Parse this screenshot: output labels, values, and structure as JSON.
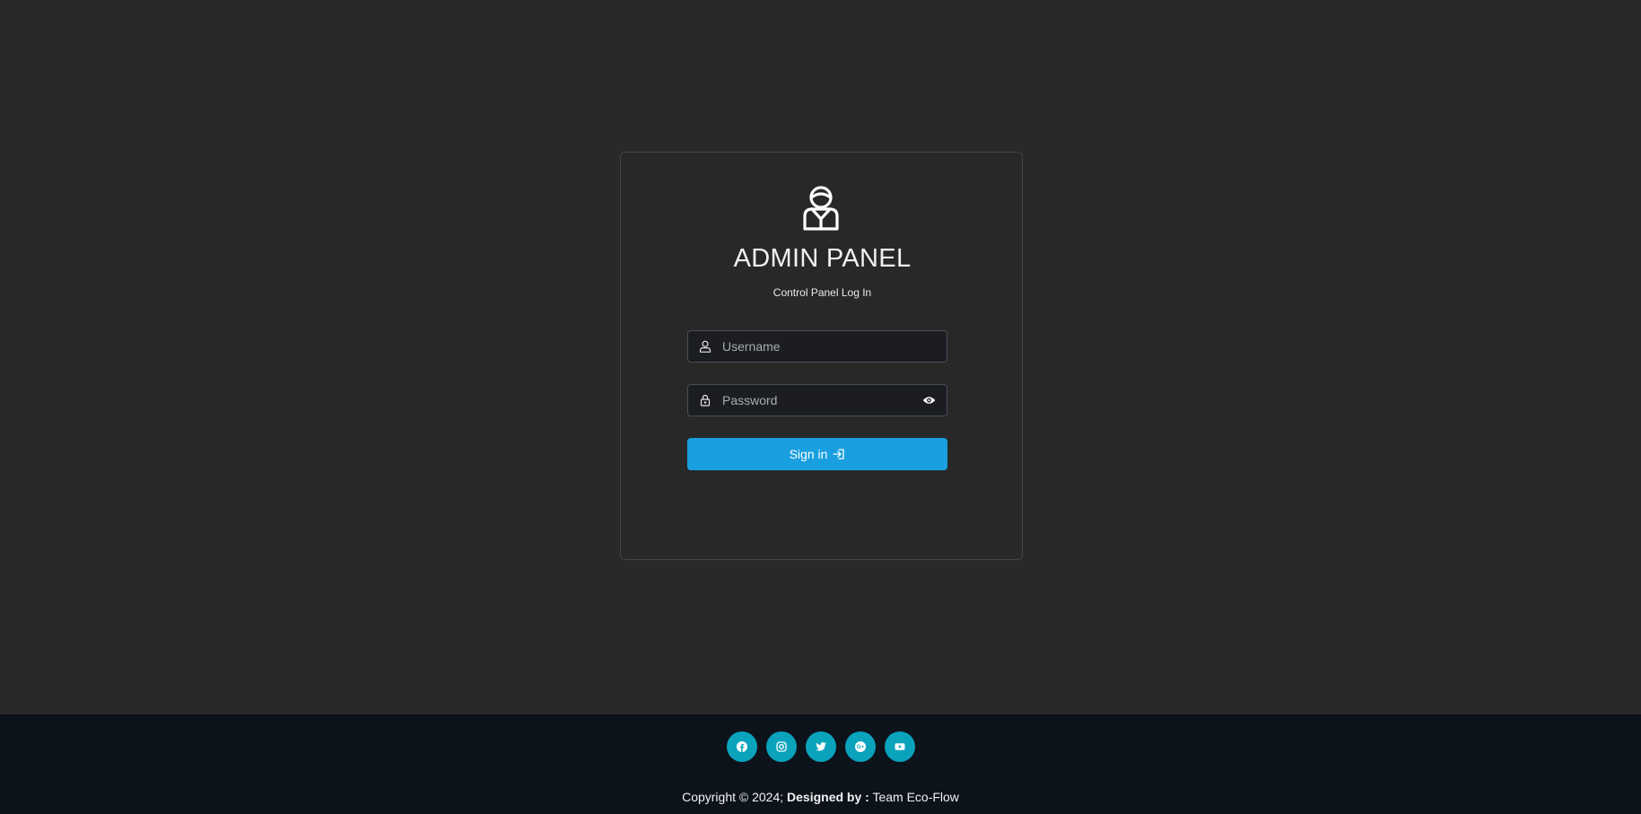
{
  "login": {
    "title": "ADMIN PANEL",
    "subtitle": "Control Panel Log In",
    "username_placeholder": "Username",
    "password_placeholder": "Password",
    "signin_label": "Sign in"
  },
  "footer": {
    "socials": [
      {
        "icon": "facebook-icon"
      },
      {
        "icon": "instagram-icon"
      },
      {
        "icon": "twitter-icon"
      },
      {
        "icon": "google-plus-icon"
      },
      {
        "icon": "youtube-icon"
      }
    ],
    "copyright_prefix": "Copyright © 2024;",
    "designed_by_label": "Designed by :",
    "designer": "Team Eco-Flow"
  },
  "colors": {
    "background": "#292929",
    "card_border": "#454545",
    "input_background": "#1b1d22",
    "accent": "#199fdf",
    "footer_background": "#0d131b",
    "social_background": "#0ba2bc"
  }
}
